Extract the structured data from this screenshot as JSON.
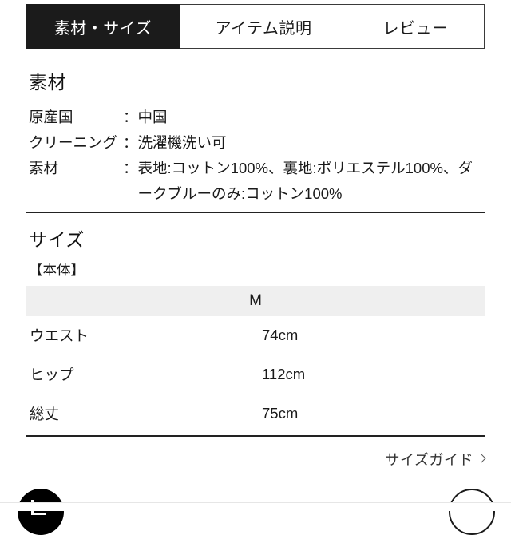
{
  "tabs": [
    {
      "label": "素材・サイズ",
      "active": true
    },
    {
      "label": "アイテム説明",
      "active": false
    },
    {
      "label": "レビュー",
      "active": false
    }
  ],
  "material": {
    "heading": "素材",
    "colon": "：",
    "rows": [
      {
        "label": "原産国",
        "value": "中国"
      },
      {
        "label": "クリーニング",
        "value": "洗濯機洗い可"
      },
      {
        "label": "素材",
        "value": "表地:コットン100%、裏地:ポリエステル100%、ダークブルーのみ:コットン100%"
      }
    ]
  },
  "size": {
    "heading": "サイズ",
    "subheading": "【本体】",
    "columns": [
      "",
      "M"
    ],
    "rows": [
      {
        "label": "ウエスト",
        "value": "74cm"
      },
      {
        "label": "ヒップ",
        "value": "112cm"
      },
      {
        "label": "総丈",
        "value": "75cm"
      }
    ],
    "guide_link": "サイズガイド"
  },
  "colors": {
    "active_tab_bg": "#1b1b1b",
    "table_header_bg": "#efefef",
    "divider_dark": "#222222",
    "row_divider": "#e2e2e2"
  }
}
